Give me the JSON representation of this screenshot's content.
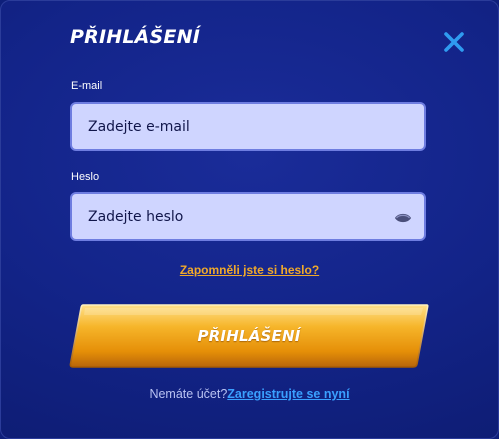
{
  "modal": {
    "title": "PŘIHLÁŠENÍ",
    "close_icon": "close-icon",
    "accent_color": "#2f9bf0"
  },
  "email": {
    "label": "E-mail",
    "placeholder": "Zadejte e-mail",
    "value": ""
  },
  "password": {
    "label": "Heslo",
    "placeholder": "Zadejte heslo",
    "value": "",
    "toggle_icon": "eye-icon"
  },
  "forgot_link": "Zapomněli jste si heslo?",
  "login_button": {
    "label": "PŘIHLÁŠENÍ",
    "color": "#f2a818"
  },
  "register": {
    "prompt": "Nemáte účet?",
    "link": "Zaregistrujte se nyní",
    "link_color": "#3aa0ff"
  }
}
